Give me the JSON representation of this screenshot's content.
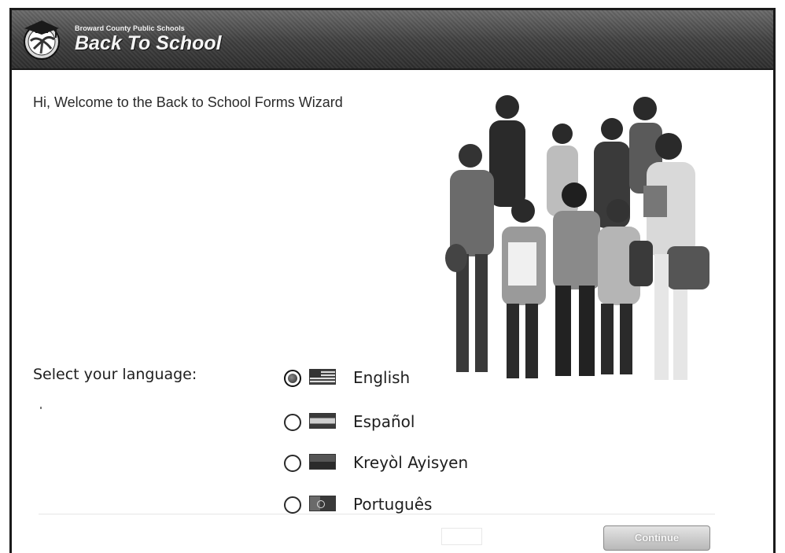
{
  "header": {
    "org_name": "Broward County Public Schools",
    "app_title": "Back To School",
    "logo_icon": "graduation-cap-palm-icon"
  },
  "welcome": {
    "text": "Hi, Welcome to the Back to School Forms Wizard"
  },
  "hero_image": {
    "icon": "students-group-photo"
  },
  "language": {
    "prompt": "Select your language:",
    "selected": "English",
    "options": [
      {
        "label": "English",
        "flag": "us-flag-icon",
        "checked": true
      },
      {
        "label": "Español",
        "flag": "spanish-flag-icon",
        "checked": false
      },
      {
        "label": "Kreyòl Ayisyen",
        "flag": "haiti-flag-icon",
        "checked": false
      },
      {
        "label": "Português",
        "flag": "portugal-flag-icon",
        "checked": false
      }
    ]
  },
  "actions": {
    "continue_label": "Continue"
  }
}
